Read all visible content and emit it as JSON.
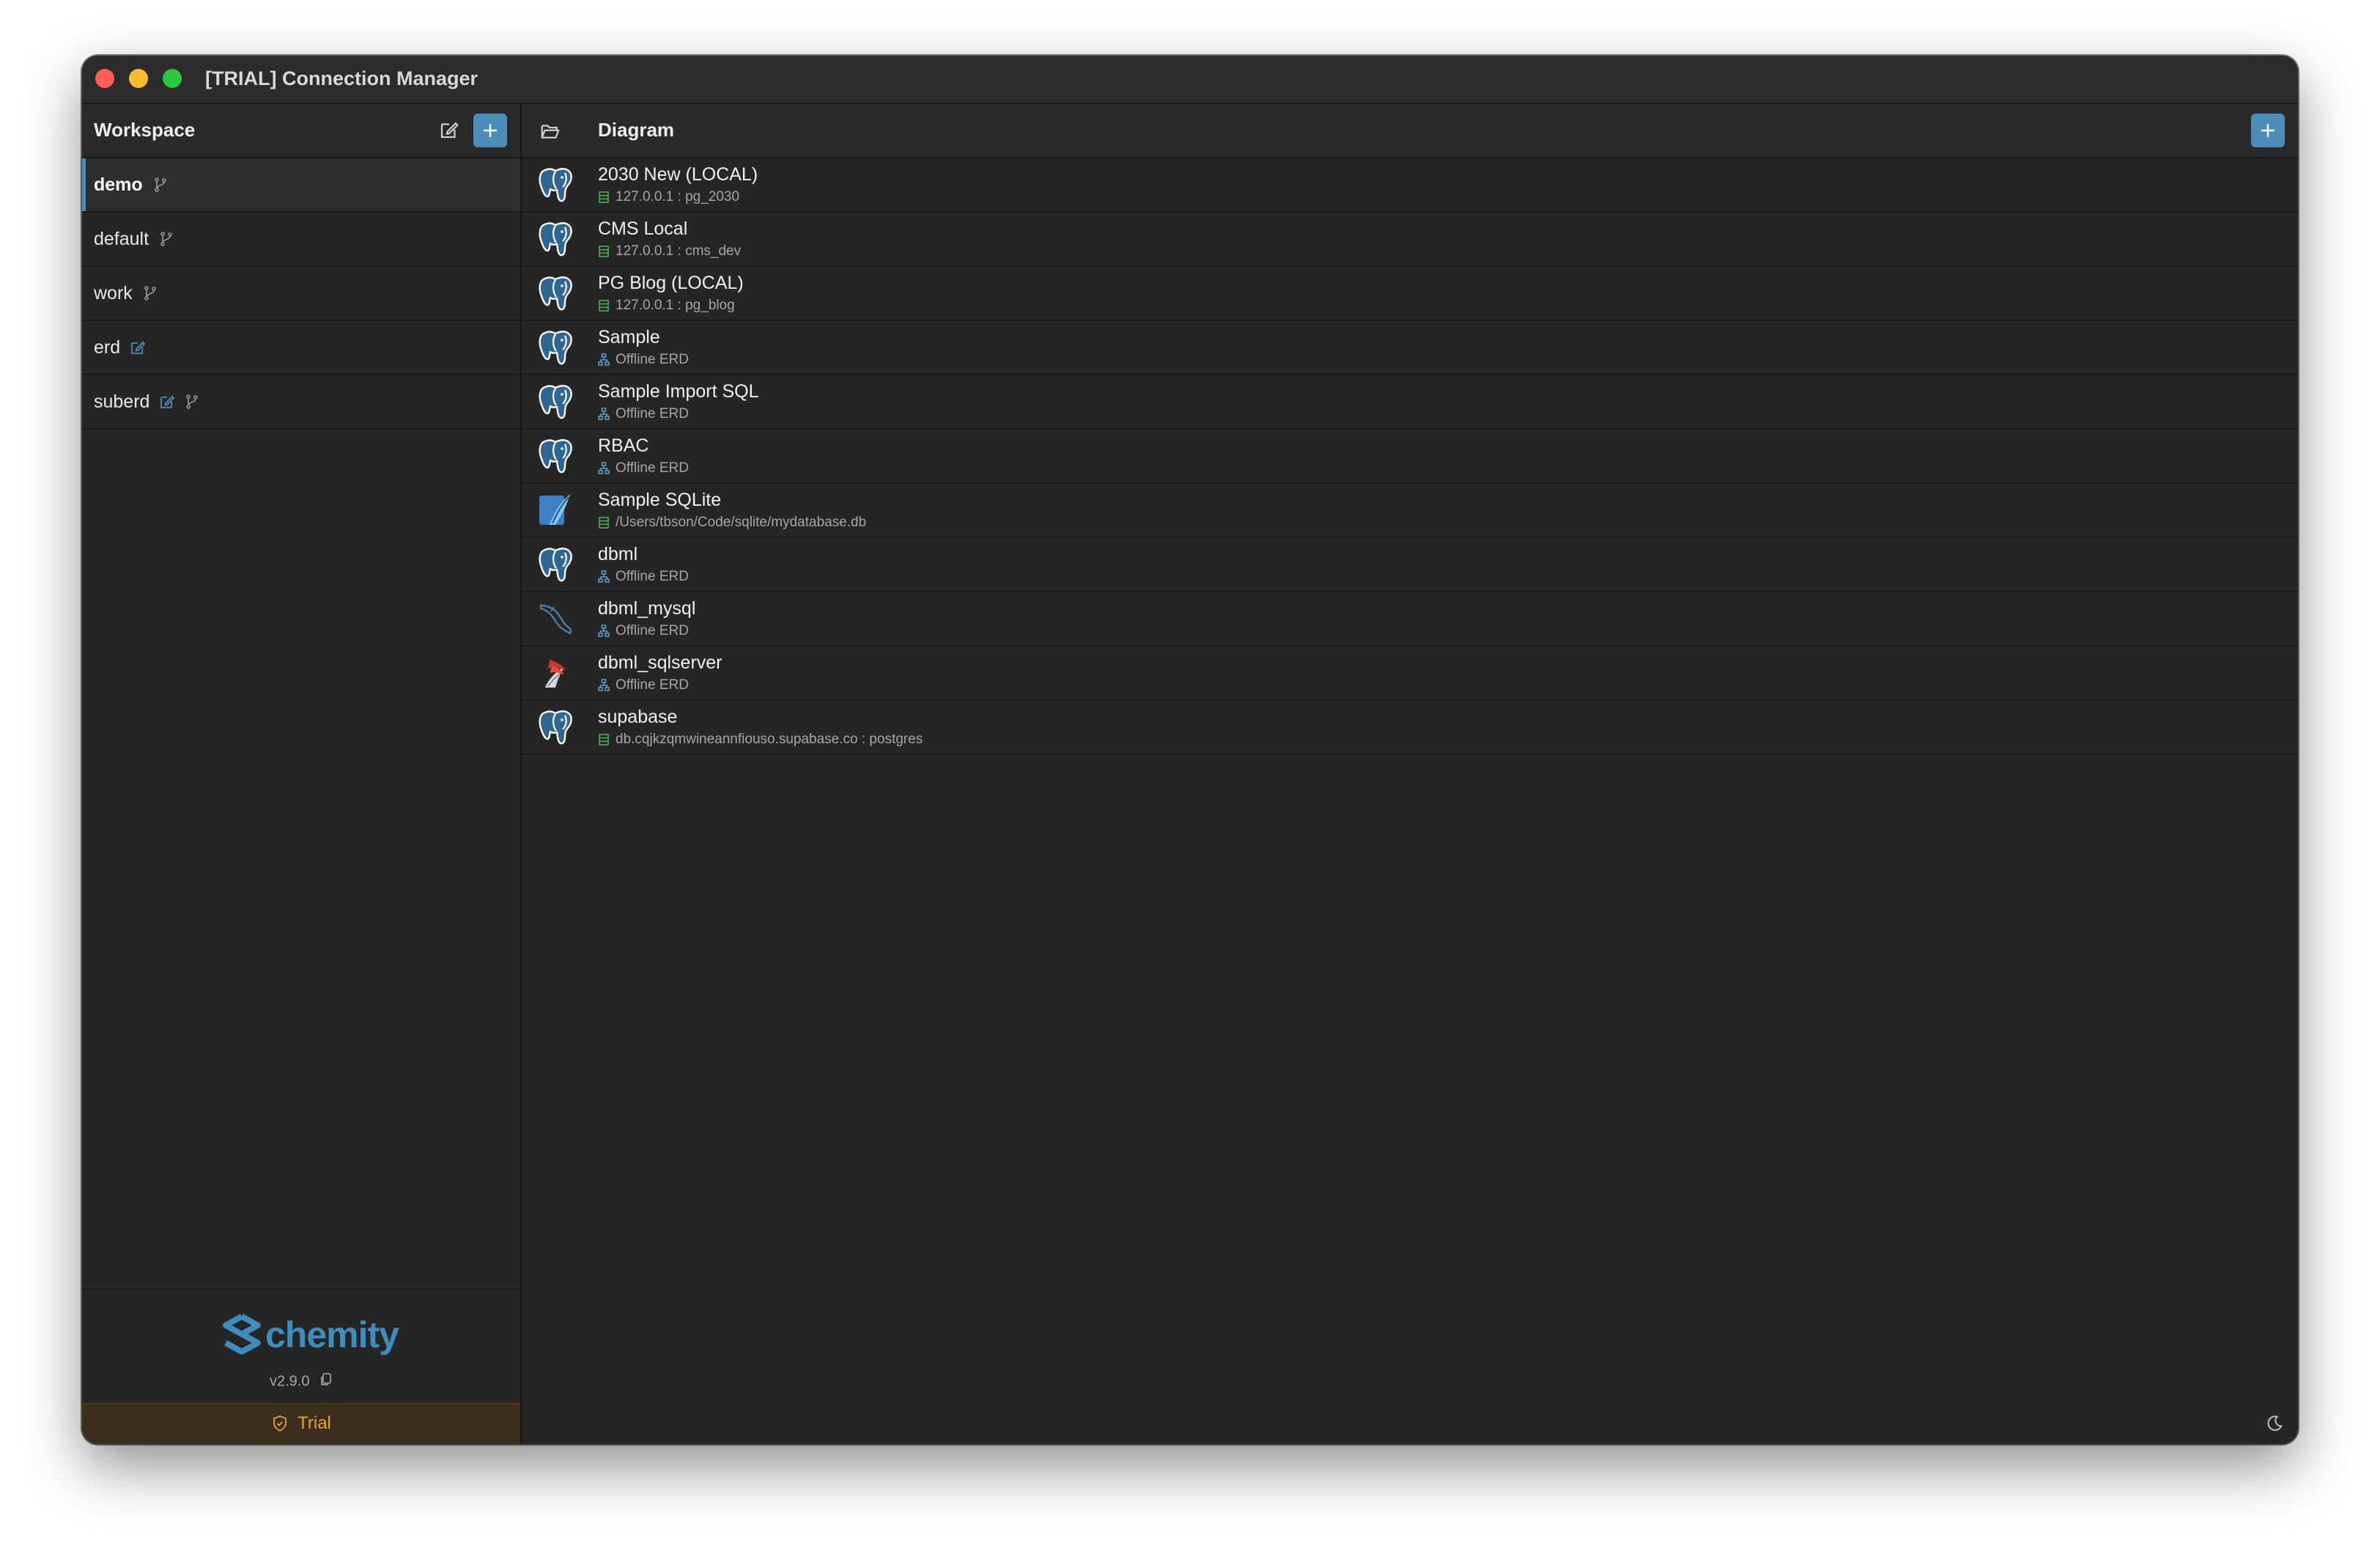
{
  "window": {
    "title": "[TRIAL] Connection Manager"
  },
  "sidebar": {
    "title": "Workspace",
    "items": [
      {
        "label": "demo",
        "active": true,
        "icons": [
          "branch-icon"
        ]
      },
      {
        "label": "default",
        "active": false,
        "icons": [
          "branch-icon"
        ]
      },
      {
        "label": "work",
        "active": false,
        "icons": [
          "branch-icon"
        ]
      },
      {
        "label": "erd",
        "active": false,
        "icons": [
          "edit-icon"
        ]
      },
      {
        "label": "suberd",
        "active": false,
        "icons": [
          "edit-icon",
          "branch-icon"
        ]
      }
    ],
    "logo_text": "chemity",
    "version": "v2.9.0",
    "trial_label": "Trial"
  },
  "main": {
    "title": "Diagram",
    "connections": [
      {
        "name": "2030 New  (LOCAL)",
        "sub": "127.0.0.1 : pg_2030",
        "db": "postgres",
        "sub_icon": "database-icon"
      },
      {
        "name": "CMS Local",
        "sub": "127.0.0.1 : cms_dev",
        "db": "postgres",
        "sub_icon": "database-icon"
      },
      {
        "name": "PG Blog  (LOCAL)",
        "sub": "127.0.0.1 : pg_blog",
        "db": "postgres",
        "sub_icon": "database-icon"
      },
      {
        "name": "Sample",
        "sub": "Offline ERD",
        "db": "postgres",
        "sub_icon": "erd-icon"
      },
      {
        "name": "Sample Import SQL",
        "sub": "Offline ERD",
        "db": "postgres",
        "sub_icon": "erd-icon"
      },
      {
        "name": "RBAC",
        "sub": "Offline ERD",
        "db": "postgres",
        "sub_icon": "erd-icon"
      },
      {
        "name": "Sample SQLite",
        "sub": "/Users/tbson/Code/sqlite/mydatabase.db",
        "db": "sqlite",
        "sub_icon": "database-icon"
      },
      {
        "name": "dbml",
        "sub": "Offline ERD",
        "db": "postgres",
        "sub_icon": "erd-icon"
      },
      {
        "name": "dbml_mysql",
        "sub": "Offline ERD",
        "db": "mysql",
        "sub_icon": "erd-icon"
      },
      {
        "name": "dbml_sqlserver",
        "sub": "Offline ERD",
        "db": "sqlserver",
        "sub_icon": "erd-icon"
      },
      {
        "name": "supabase",
        "sub": "db.cqjkzqmwineannfiouso.supabase.co : postgres",
        "db": "postgres",
        "sub_icon": "database-icon"
      }
    ]
  },
  "colors": {
    "accent": "#4b8eb9",
    "logo": "#3e8dbf",
    "trial": "#e8a23c",
    "database_icon": "#4caf50",
    "erd_icon": "#5b9fd1"
  }
}
